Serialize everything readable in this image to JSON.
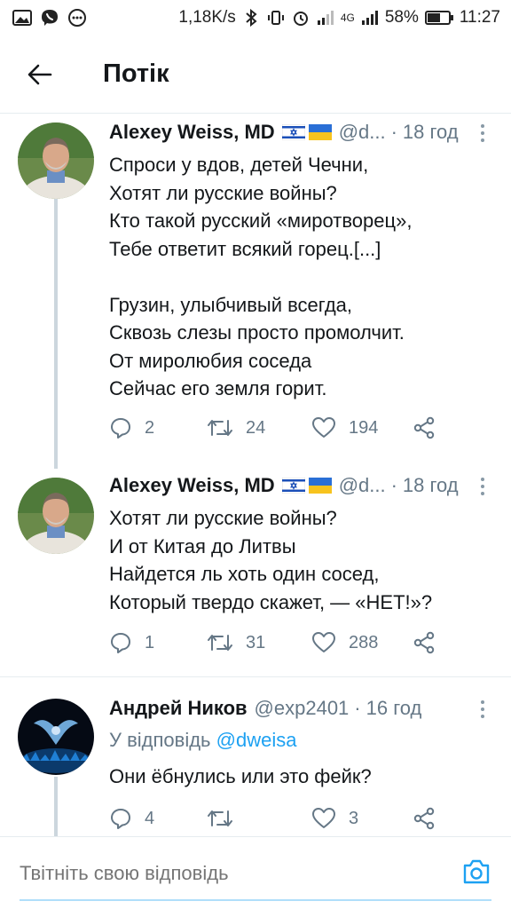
{
  "status_bar": {
    "speed": "1,18K/s",
    "network_label": "4G",
    "battery": "58%",
    "time": "11:27"
  },
  "header": {
    "title": "Потік"
  },
  "tweets": [
    {
      "name": "Alexey Weiss, MD",
      "handle": "@d...",
      "dot": "·",
      "time": "18 год",
      "text": "Спроси у вдов, детей Чечни,\nХотят ли русские войны?\nКто такой русский «миротворец»,\nТебе ответит всякий горец.[...]\n\nГрузин, улыбчивый всегда,\nСквозь слезы просто промолчит.\nОт миролюбия соседа\nСейчас его земля горит.",
      "replies": "2",
      "retweets": "24",
      "likes": "194"
    },
    {
      "name": "Alexey Weiss, MD",
      "handle": "@d...",
      "dot": "·",
      "time": "18 год",
      "text": "Хотят ли русские войны?\nИ от Китая до Литвы\nНайдется ль хоть один сосед,\nКоторый твердо скажет, — «НЕТ!»?",
      "replies": "1",
      "retweets": "31",
      "likes": "288"
    },
    {
      "name": "Андрей Ников",
      "handle": "@exp2401",
      "dot": "·",
      "time": "16 год",
      "reply_prefix": "У відповідь",
      "reply_mention": "@dweisa",
      "text": "Они ёбнулись или это фейк?",
      "replies": "4",
      "retweets": "",
      "likes": "3"
    }
  ],
  "reply_bar": {
    "placeholder": "Твітніть свою відповідь"
  },
  "icons": {
    "back": "arrow-left-icon",
    "reply": "comment-icon",
    "retweet": "retweet-icon",
    "like": "heart-icon",
    "share": "share-icon",
    "more": "more-vertical-icon",
    "camera": "camera-icon"
  },
  "colors": {
    "accent": "#1da1f2",
    "secondary_text": "#657786",
    "border": "#e6ecf0"
  }
}
